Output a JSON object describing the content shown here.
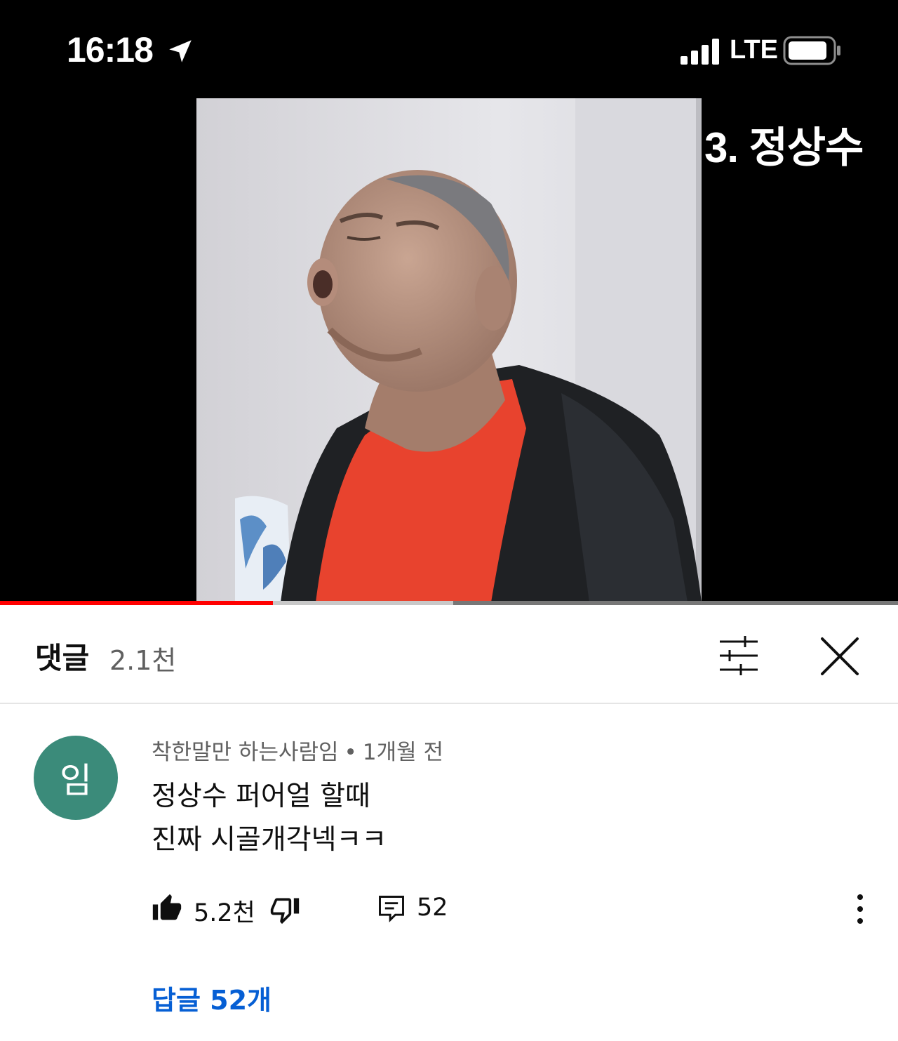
{
  "status_bar": {
    "time": "16:18",
    "network": "LTE",
    "icons": [
      "location-arrow-icon",
      "signal-bars-icon",
      "battery-icon"
    ]
  },
  "video": {
    "overlay_title": "3. 정상수",
    "progress_played_fraction": 0.304,
    "progress_buffered_fraction": 0.505,
    "colors": {
      "played": "#ff0000",
      "buffered": "#c8c8c8",
      "track": "#777777"
    }
  },
  "comments_panel": {
    "title": "댓글",
    "count": "2.1천",
    "icons": [
      "sort-sliders-icon",
      "close-icon"
    ]
  },
  "comment": {
    "avatar_letter": "임",
    "avatar_color": "#3b8b7a",
    "author": "착한말만 하는사람임",
    "separator": "•",
    "time_ago": "1개월 전",
    "lines": [
      "정상수 퍼어얼 할때",
      "진짜 시골개각넥ㅋㅋ"
    ],
    "likes": "5.2천",
    "reply_count": "52",
    "icons": [
      "thumbs-up-filled-icon",
      "thumbs-down-icon",
      "reply-comment-icon",
      "more-vertical-icon"
    ]
  },
  "replies_link": "답글 52개",
  "accent_color": "#065fd4"
}
